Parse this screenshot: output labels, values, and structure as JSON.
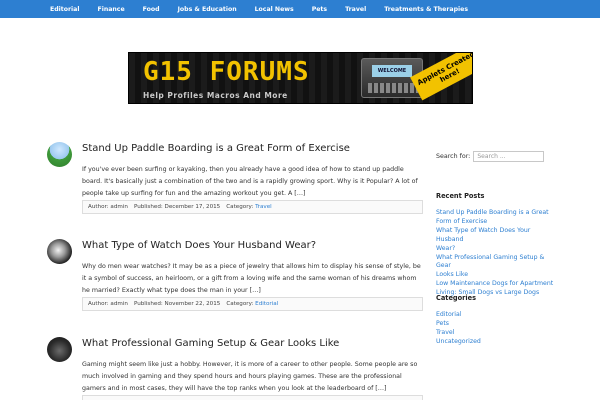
{
  "nav": {
    "items": [
      {
        "label": "Editorial"
      },
      {
        "label": "Finance"
      },
      {
        "label": "Food"
      },
      {
        "label": "Jobs & Education"
      },
      {
        "label": "Local News"
      },
      {
        "label": "Pets"
      },
      {
        "label": "Travel"
      },
      {
        "label": "Treatments & Therapies"
      }
    ]
  },
  "banner": {
    "logo": "G15 FORUMS",
    "tags": "Help   Profiles   Macros   And More",
    "device_screen": "WELCOME",
    "corner_text": "Applets Created here!"
  },
  "posts": [
    {
      "title": "Stand Up Paddle Boarding is a Great Form of Exercise",
      "excerpt": "If you've ever been surfing or kayaking, then you already have a good idea of how to stand up paddle board. It's basically just a combination of the two and is a rapidly growing sport. Why is it Popular? A lot of people take up surfing for fun and the amazing workout you get. A […]",
      "author_label": "Author:",
      "author": "admin",
      "published_label": "Published:",
      "date": "December 17, 2015",
      "category_label": "Category:",
      "category": "Travel",
      "avatar_icon": "paddleboard-photo-icon"
    },
    {
      "title": "What Type of Watch Does Your Husband Wear?",
      "excerpt": "Why do men wear watches? It may be as a piece of jewelry that allows him to display his sense of style, be it a symbol of success, an heirloom, or a gift from a loving wife and the same woman of his dreams whom he married? Exactly what type does the man in your […]",
      "author_label": "Author:",
      "author": "admin",
      "published_label": "Published:",
      "date": "November 22, 2015",
      "category_label": "Category:",
      "category": "Editorial",
      "avatar_icon": "watch-photo-icon"
    },
    {
      "title": "What Professional Gaming Setup & Gear Looks Like",
      "excerpt": "Gaming might seem like just a hobby. However, it is more of a career to other people. Some people are so much involved in gaming and they spend hours and hours playing games. These are the professional gamers and in most cases, they will have the top ranks when you look at the leaderboard of […]",
      "avatar_icon": "gaming-gear-photo-icon"
    }
  ],
  "sidebar": {
    "search_label": "Search for:",
    "search_placeholder": "Search ...",
    "recent_title": "Recent Posts",
    "recent_posts": [
      {
        "label": "Stand Up Paddle Boarding is a Great"
      },
      {
        "label": "Form of Exercise"
      },
      {
        "label": "What Type of Watch Does Your Husband"
      },
      {
        "label": "Wear?"
      },
      {
        "label": "What Professional Gaming Setup & Gear"
      },
      {
        "label": "Looks Like"
      },
      {
        "label": "Low Maintenance Dogs for Apartment"
      },
      {
        "label": "Living: Small Dogs vs Large Dogs"
      }
    ],
    "categories_title": "Categories",
    "categories": [
      {
        "label": "Editorial"
      },
      {
        "label": "Pets"
      },
      {
        "label": "Travel"
      },
      {
        "label": "Uncategorized"
      }
    ]
  },
  "colors": {
    "nav_bg": "#2d7fd1",
    "link": "#2d7fd1",
    "banner_accent": "#f2c200"
  }
}
